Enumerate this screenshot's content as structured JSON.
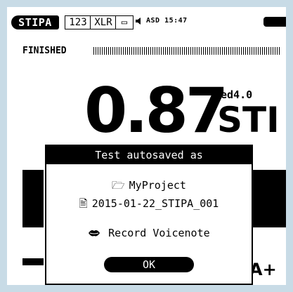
{
  "status_bar": {
    "mode": "STIPA",
    "box_123": "123",
    "box_xlr": "XLR",
    "box_mem_glyph": "▭",
    "info": "ASD 15:47"
  },
  "measurement": {
    "status": "FINISHED",
    "progress": 1.0,
    "value": "0.87",
    "edition": "ed4.0",
    "unit": "STI"
  },
  "dialog": {
    "title": "Test autosaved as",
    "project": "MyProject",
    "file": "2015-01-22_STIPA_001",
    "voicenote": "Record Voicenote",
    "ok": "OK"
  },
  "background_partial": {
    "label": "A+"
  },
  "icons": {
    "folder": "folder-icon",
    "file": "file-icon",
    "voicenote": "lips-icon",
    "speaker": "speaker-icon",
    "battery": "battery-icon"
  }
}
